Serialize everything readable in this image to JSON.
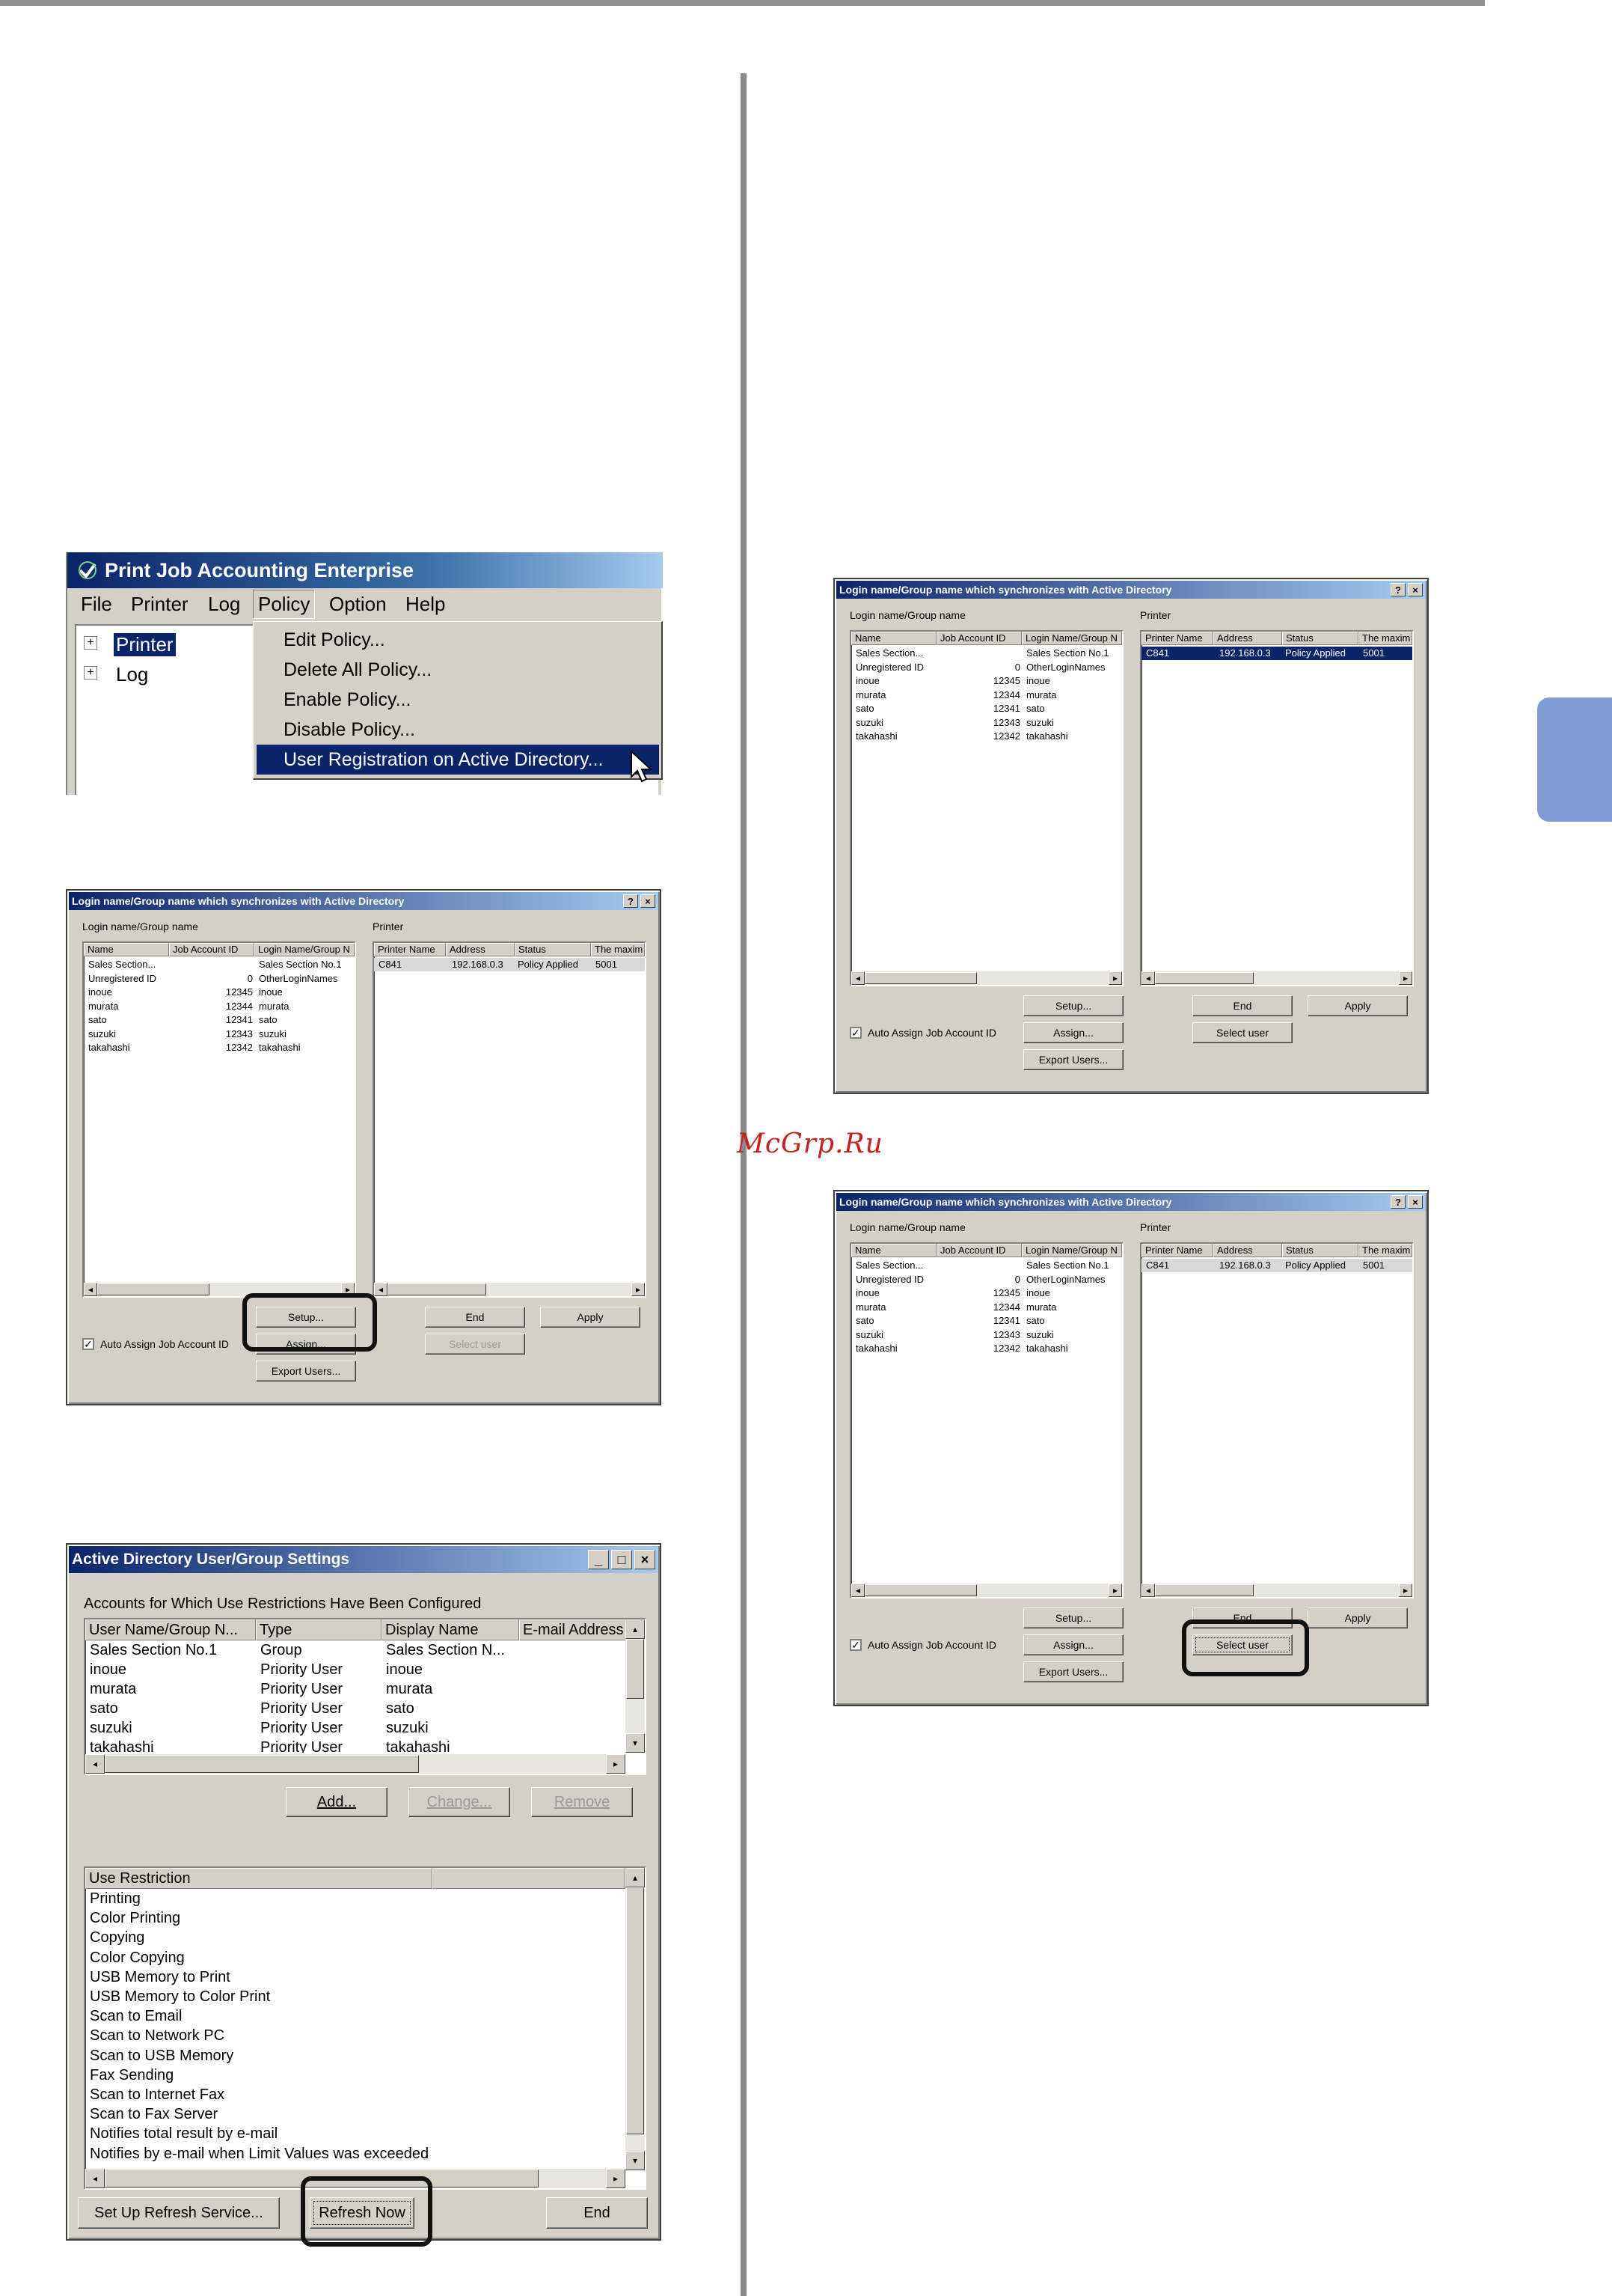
{
  "watermark": "McGrp.Ru",
  "pje": {
    "title": "Print Job Accounting Enterprise",
    "menu": [
      "File",
      "Printer",
      "Log",
      "Policy",
      "Option",
      "Help"
    ],
    "tree": [
      "Printer",
      "Log"
    ],
    "dropdown": [
      "Edit Policy...",
      "Delete All Policy...",
      "Enable Policy...",
      "Disable Policy...",
      "User Registration on Active Directory..."
    ]
  },
  "login_dialog": {
    "title": "Login name/Group name which synchronizes with Active Directory",
    "left_label": "Login name/Group name",
    "right_label": "Printer",
    "user_headers": [
      "Name",
      "Job Account ID",
      "Login Name/Group N"
    ],
    "users": [
      [
        "Sales Section...",
        "",
        "Sales Section No.1"
      ],
      [
        "Unregistered ID",
        "0",
        "OtherLoginNames"
      ],
      [
        "inoue",
        "12345",
        "inoue"
      ],
      [
        "murata",
        "12344",
        "murata"
      ],
      [
        "sato",
        "12341",
        "sato"
      ],
      [
        "suzuki",
        "12343",
        "suzuki"
      ],
      [
        "takahashi",
        "12342",
        "takahashi"
      ]
    ],
    "printer_headers": [
      "Printer Name",
      "Address",
      "Status",
      "The maxim"
    ],
    "printers": [
      [
        "C841",
        "192.168.0.3",
        "Policy Applied",
        "5001"
      ]
    ],
    "checkbox_label": "Auto Assign Job Account ID",
    "buttons": {
      "setup": "Setup...",
      "assign": "Assign...",
      "export": "Export Users...",
      "end": "End",
      "apply": "Apply",
      "select_user": "Select user"
    }
  },
  "ad_dialog": {
    "title": "Active Directory User/Group Settings",
    "accounts_label": "Accounts for Which Use Restrictions Have Been Configured",
    "headers": [
      "User Name/Group N...",
      "Type",
      "Display Name",
      "E-mail Address"
    ],
    "rows": [
      [
        "Sales Section No.1",
        "Group",
        "Sales Section N..."
      ],
      [
        "inoue",
        "Priority User",
        "inoue"
      ],
      [
        "murata",
        "Priority User",
        "murata"
      ],
      [
        "sato",
        "Priority User",
        "sato"
      ],
      [
        "suzuki",
        "Priority User",
        "suzuki"
      ],
      [
        "takahashi",
        "Priority User",
        "takahashi"
      ]
    ],
    "buttons": {
      "add": "Add...",
      "change": "Change...",
      "remove": "Remove",
      "refresh_service": "Set Up Refresh Service...",
      "refresh_now": "Refresh Now",
      "end": "End"
    },
    "restriction_header": "Use Restriction",
    "restrictions": [
      "Printing",
      "Color Printing",
      "Copying",
      "Color Copying",
      "USB Memory to Print",
      "USB Memory to Color Print",
      "Scan to Email",
      "Scan to Network PC",
      "Scan to USB Memory",
      "Fax Sending",
      "Scan to Internet Fax",
      "Scan to Fax Server",
      "Notifies total result by e-mail",
      "Notifies by e-mail when Limit Values was exceeded"
    ]
  }
}
